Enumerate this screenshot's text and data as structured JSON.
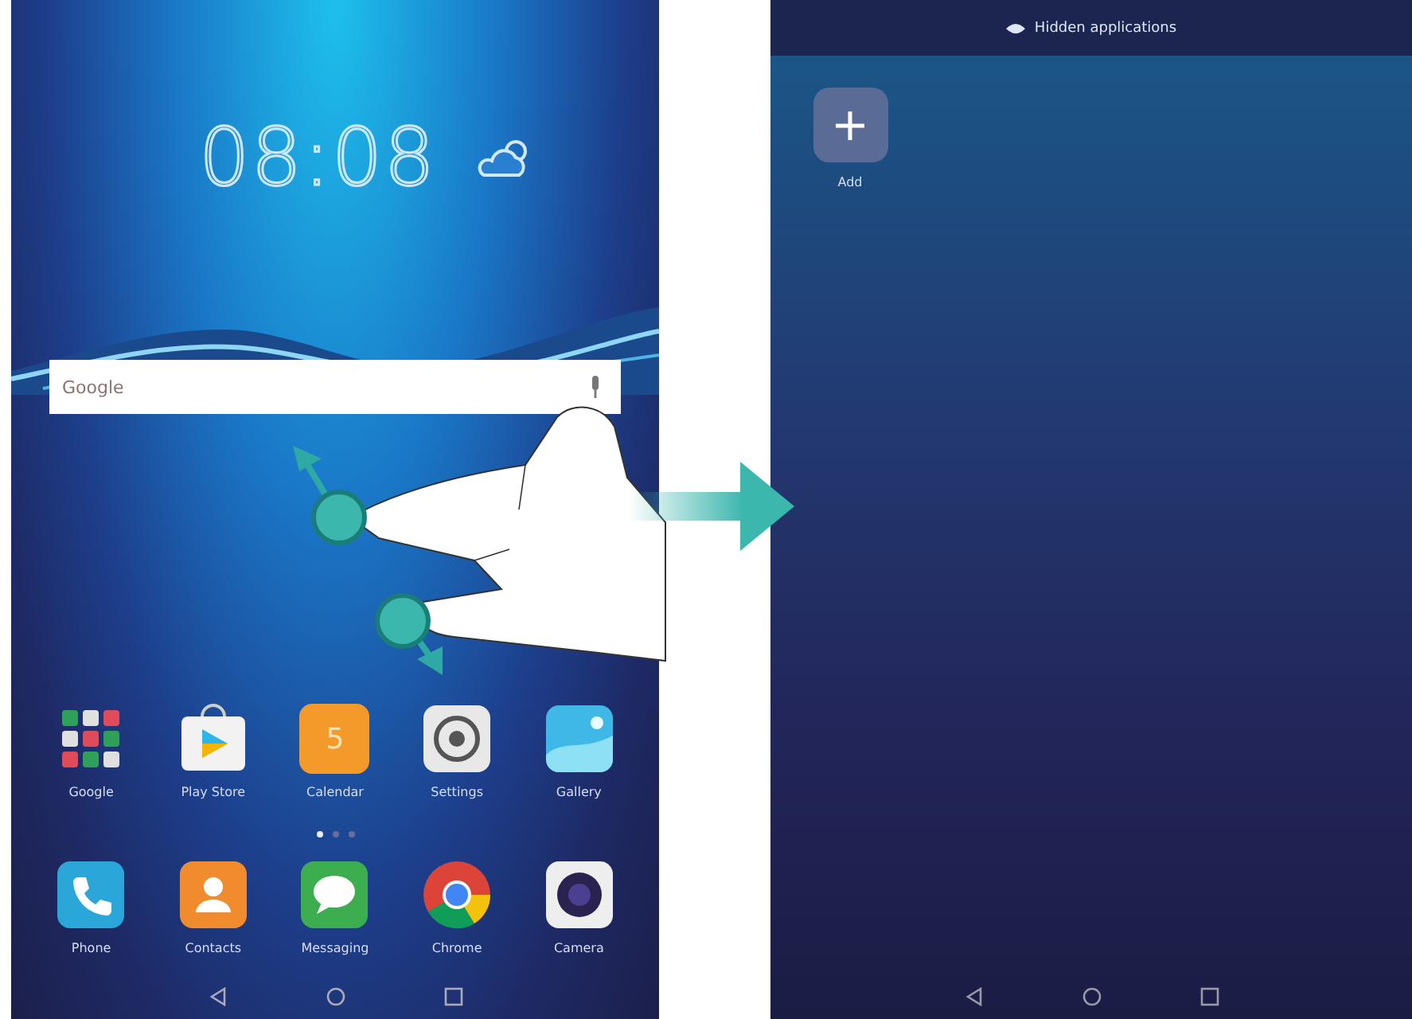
{
  "home_screen": {
    "clock": "08:08",
    "search_bar": {
      "placeholder": "Google"
    },
    "apps": [
      {
        "label": "Google",
        "kind": "folder"
      },
      {
        "label": "Play Store",
        "kind": "store"
      },
      {
        "label": "Calendar",
        "kind": "calendar",
        "icon_text": "5"
      },
      {
        "label": "Settings",
        "kind": "settings"
      },
      {
        "label": "Gallery",
        "kind": "gallery"
      }
    ],
    "page_dots": [
      {
        "selected": true
      },
      {
        "selected": false
      },
      {
        "selected": false
      }
    ],
    "dock": [
      {
        "label": "Phone",
        "kind": "phone"
      },
      {
        "label": "Contacts",
        "kind": "contacts"
      },
      {
        "label": "Messaging",
        "kind": "messaging"
      },
      {
        "label": "Chrome",
        "kind": "browser"
      },
      {
        "label": "Camera",
        "kind": "camera"
      }
    ]
  },
  "hidden_apps_screen": {
    "title": "Hidden applications",
    "add_tile": {
      "label": "Add"
    }
  }
}
